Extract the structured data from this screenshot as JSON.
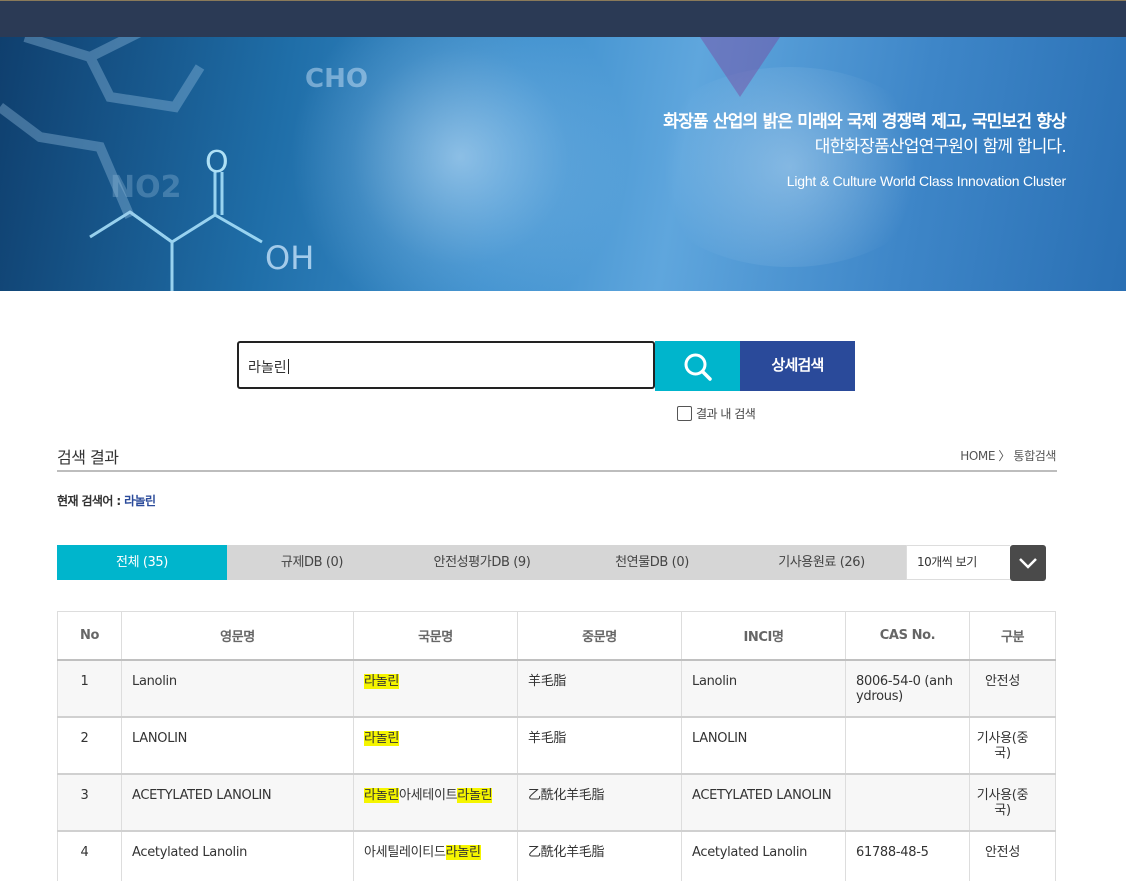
{
  "banner": {
    "line1": "화장품 산업의 밝은 미래와 국제 경쟁력 제고, 국민보건 향상",
    "line2": "대한화장품산업연구원이 함께 합니다.",
    "line3": "Light & Culture World Class Innovation Cluster",
    "deco_cho": "CHO",
    "deco_no2": "NO2",
    "deco_o": "O",
    "deco_oh": "OH"
  },
  "search": {
    "query": "라놀린",
    "search_icon": "search-icon",
    "detail_label": "상세검색",
    "within_label": "결과 내 검색"
  },
  "results": {
    "title": "검색 결과",
    "breadcrumb": "HOME 〉 통합검색",
    "current_label": "현재 검색어 : ",
    "current_keyword": "라놀린"
  },
  "tabs": [
    {
      "label": "전체 (35)"
    },
    {
      "label": "규제DB (0)"
    },
    {
      "label": "안전성평가DB (9)"
    },
    {
      "label": "천연물DB (0)"
    },
    {
      "label": "기사용원료 (26)"
    }
  ],
  "per_page": {
    "label": "10개씩 보기",
    "icon": "chevron-down-icon"
  },
  "table": {
    "headers": [
      "No",
      "영문명",
      "국문명",
      "중문명",
      "INCI명",
      "CAS No.",
      "구분"
    ],
    "rows": [
      {
        "no": "1",
        "en": "Lanolin",
        "ko": [
          {
            "t": "라놀린",
            "h": true
          }
        ],
        "zh": "羊毛脂",
        "inci": "Lanolin",
        "cas": "8006-54-0 (anhydrous)",
        "type": "안전성"
      },
      {
        "no": "2",
        "en": "LANOLIN",
        "ko": [
          {
            "t": "라놀린",
            "h": true
          }
        ],
        "zh": "羊毛脂",
        "inci": "LANOLIN",
        "cas": "",
        "type": "기사용(중국)"
      },
      {
        "no": "3",
        "en": "ACETYLATED LANOLIN",
        "ko": [
          {
            "t": "라놀린",
            "h": true
          },
          {
            "t": "아세테이트",
            "h": false
          },
          {
            "t": "라놀린",
            "h": true
          }
        ],
        "zh": "乙酰化羊毛脂",
        "inci": "ACETYLATED LANOLIN",
        "cas": "",
        "type": "기사용(중국)"
      },
      {
        "no": "4",
        "en": "Acetylated Lanolin",
        "ko": [
          {
            "t": "아세틸레이티드",
            "h": false
          },
          {
            "t": "라놀린",
            "h": true
          }
        ],
        "zh": "乙酰化羊毛脂",
        "inci": "Acetylated Lanolin",
        "cas": "61788-48-5",
        "type": "안전성"
      }
    ]
  },
  "colors": {
    "topbar": "#2b3a55",
    "accent_cyan": "#00b5cc",
    "accent_navy": "#2a4a9a",
    "highlight": "#f5f500"
  }
}
